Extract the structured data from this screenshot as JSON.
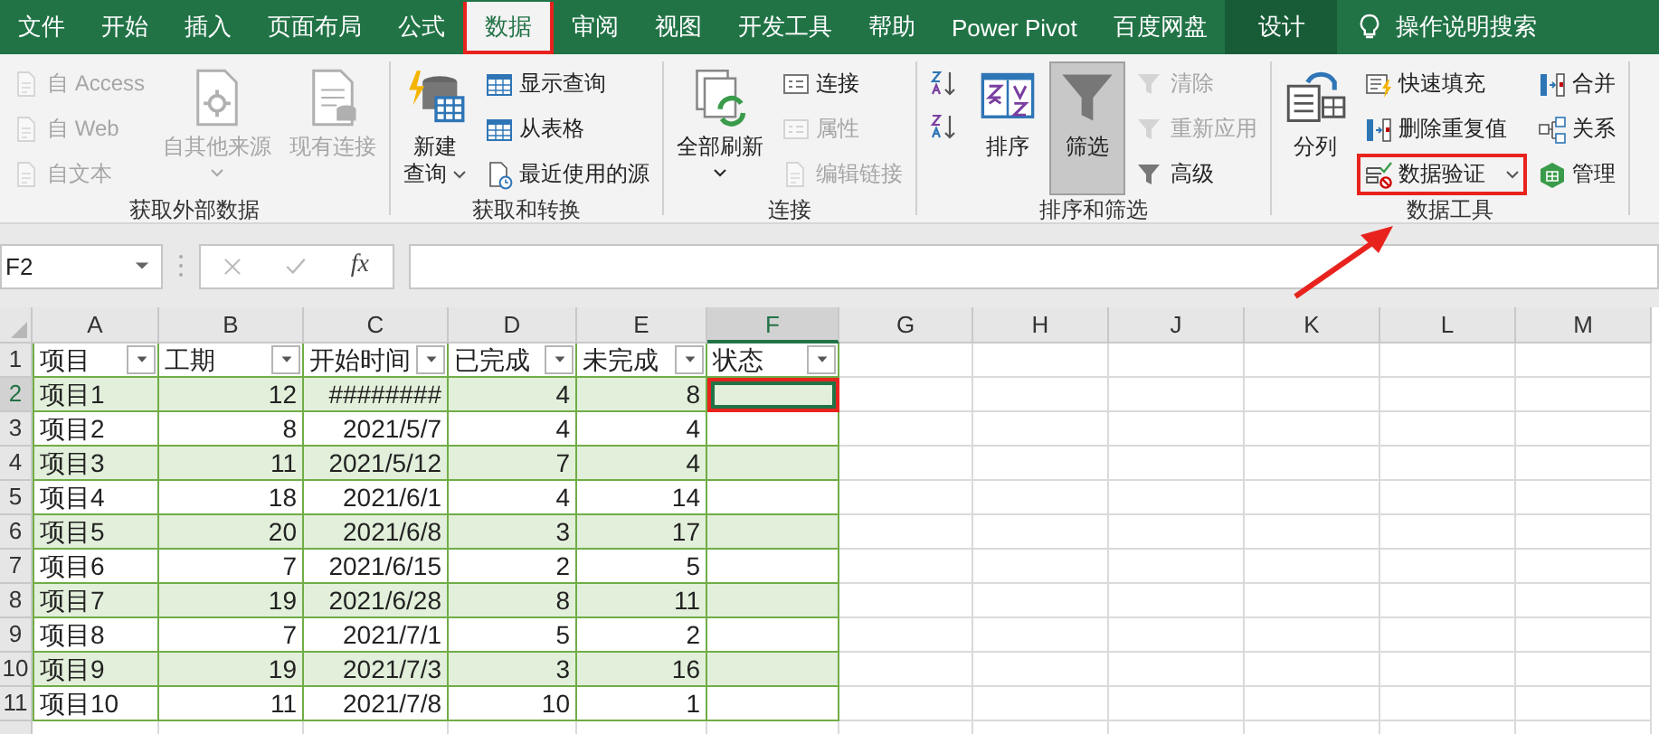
{
  "tabs": [
    {
      "label": "文件",
      "selected": false,
      "kind": "normal",
      "annotated": false
    },
    {
      "label": "开始",
      "selected": false,
      "kind": "normal",
      "annotated": false
    },
    {
      "label": "插入",
      "selected": false,
      "kind": "normal",
      "annotated": false
    },
    {
      "label": "页面布局",
      "selected": false,
      "kind": "normal",
      "annotated": false
    },
    {
      "label": "公式",
      "selected": false,
      "kind": "normal",
      "annotated": false
    },
    {
      "label": "数据",
      "selected": true,
      "kind": "normal",
      "annotated": true
    },
    {
      "label": "审阅",
      "selected": false,
      "kind": "normal",
      "annotated": false
    },
    {
      "label": "视图",
      "selected": false,
      "kind": "normal",
      "annotated": false
    },
    {
      "label": "开发工具",
      "selected": false,
      "kind": "normal",
      "annotated": false
    },
    {
      "label": "帮助",
      "selected": false,
      "kind": "normal",
      "annotated": false
    },
    {
      "label": "Power Pivot",
      "selected": false,
      "kind": "normal",
      "annotated": false
    },
    {
      "label": "百度网盘",
      "selected": false,
      "kind": "normal",
      "annotated": false
    },
    {
      "label": "设计",
      "selected": false,
      "kind": "contextual",
      "annotated": false
    }
  ],
  "tell_me": {
    "label": "操作说明搜索"
  },
  "ribbon": {
    "groups": [
      {
        "label": "获取外部数据",
        "columns": [
          {
            "kind": "stack",
            "items": [
              {
                "label": "自 Access",
                "disabled": true
              },
              {
                "label": "自 Web",
                "disabled": true
              },
              {
                "label": "自文本",
                "disabled": true
              }
            ]
          },
          {
            "kind": "large",
            "lines": [
              "自其他来源"
            ],
            "disabled": true,
            "caret": true
          },
          {
            "kind": "large",
            "lines": [
              "现有连接"
            ],
            "disabled": true
          }
        ]
      },
      {
        "label": "获取和转换",
        "columns": [
          {
            "kind": "large",
            "lines": [
              "新建",
              "查询"
            ],
            "disabled": false,
            "caret": true
          },
          {
            "kind": "stack",
            "items": [
              {
                "label": "显示查询",
                "disabled": false
              },
              {
                "label": "从表格",
                "disabled": false
              },
              {
                "label": "最近使用的源",
                "disabled": false
              }
            ]
          }
        ]
      },
      {
        "label": "连接",
        "columns": [
          {
            "kind": "large",
            "lines": [
              "全部刷新"
            ],
            "disabled": false,
            "caret": true
          },
          {
            "kind": "stack",
            "items": [
              {
                "label": "连接",
                "disabled": false
              },
              {
                "label": "属性",
                "disabled": true
              },
              {
                "label": "编辑链接",
                "disabled": true
              }
            ]
          }
        ]
      },
      {
        "label": "排序和筛选",
        "columns": [
          {
            "kind": "stack",
            "items": [
              {
                "disabled": false
              },
              {
                "disabled": false
              }
            ]
          },
          {
            "kind": "large",
            "lines": [
              "排序"
            ],
            "disabled": false,
            "pressed": false
          },
          {
            "kind": "large",
            "lines": [
              "筛选"
            ],
            "disabled": false,
            "pressed": true
          },
          {
            "kind": "stack",
            "items": [
              {
                "label": "清除",
                "disabled": true
              },
              {
                "label": "重新应用",
                "disabled": true
              },
              {
                "label": "高级",
                "disabled": false
              }
            ]
          }
        ]
      },
      {
        "label": "数据工具",
        "columns": [
          {
            "kind": "large",
            "lines": [
              "分列"
            ],
            "disabled": false
          },
          {
            "kind": "stack",
            "items": [
              {
                "label": "快速填充",
                "disabled": false,
                "annotated": false
              },
              {
                "label": "删除重复值",
                "disabled": false,
                "annotated": false
              },
              {
                "label": "数据验证",
                "disabled": false,
                "caret": true,
                "annotated": true
              }
            ]
          },
          {
            "kind": "stack",
            "items": [
              {
                "label": "合并",
                "disabled": false
              },
              {
                "label": "关系",
                "disabled": false
              },
              {
                "label": "管理",
                "disabled": false
              }
            ]
          }
        ]
      }
    ]
  },
  "formula_bar": {
    "name_box": "F2",
    "fx": "fx"
  },
  "annotation_arrow": true,
  "sheet": {
    "columns": [
      {
        "label": "A",
        "selected": false
      },
      {
        "label": "B",
        "selected": false
      },
      {
        "label": "C",
        "selected": false
      },
      {
        "label": "D",
        "selected": false
      },
      {
        "label": "E",
        "selected": false
      },
      {
        "label": "F",
        "selected": true
      },
      {
        "label": "G",
        "selected": false
      },
      {
        "label": "H",
        "selected": false
      },
      {
        "label": "J",
        "selected": false
      },
      {
        "label": "K",
        "selected": false
      },
      {
        "label": "L",
        "selected": false
      },
      {
        "label": "M",
        "selected": false
      }
    ],
    "header_row": {
      "number": "1",
      "selected": false,
      "cells": [
        "项目",
        "工期",
        "开始时间",
        "已完成",
        "未完成",
        "状态"
      ]
    },
    "annotate_active_cell": true,
    "rows": [
      {
        "number": "2",
        "selected": true,
        "cells": [
          "项目1",
          "12",
          "########",
          "4",
          "8"
        ]
      },
      {
        "number": "3",
        "selected": false,
        "cells": [
          "项目2",
          "8",
          "2021/5/7",
          "4",
          "4"
        ]
      },
      {
        "number": "4",
        "selected": false,
        "cells": [
          "项目3",
          "11",
          "2021/5/12",
          "7",
          "4"
        ]
      },
      {
        "number": "5",
        "selected": false,
        "cells": [
          "项目4",
          "18",
          "2021/6/1",
          "4",
          "14"
        ]
      },
      {
        "number": "6",
        "selected": false,
        "cells": [
          "项目5",
          "20",
          "2021/6/8",
          "3",
          "17"
        ]
      },
      {
        "number": "7",
        "selected": false,
        "cells": [
          "项目6",
          "7",
          "2021/6/15",
          "2",
          "5"
        ]
      },
      {
        "number": "8",
        "selected": false,
        "cells": [
          "项目7",
          "19",
          "2021/6/28",
          "8",
          "11"
        ]
      },
      {
        "number": "9",
        "selected": false,
        "cells": [
          "项目8",
          "7",
          "2021/7/1",
          "5",
          "2"
        ]
      },
      {
        "number": "10",
        "selected": false,
        "cells": [
          "项目9",
          "19",
          "2021/7/3",
          "3",
          "16"
        ]
      },
      {
        "number": "11",
        "selected": false,
        "cells": [
          "项目10",
          "11",
          "2021/7/8",
          "10",
          "1"
        ]
      }
    ]
  }
}
